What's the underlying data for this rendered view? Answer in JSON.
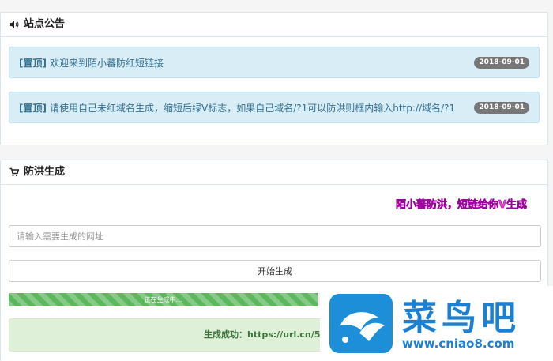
{
  "announcements": {
    "title": "站点公告",
    "items": [
      {
        "tag": "[置顶]",
        "text": "欢迎来到陌小蕃防红短链接",
        "date": "2018-09-01"
      },
      {
        "tag": "[置顶]",
        "text": "请使用自己未红域名生成，缩短后绿V标志，如果自己域名/?1可以防洪则框内输入http://域名/?1",
        "date": "2018-09-01"
      }
    ]
  },
  "generator": {
    "title": "防洪生成",
    "marquee": "陌小蕃防洪，短链给你V生成",
    "input_placeholder": "请输入需要生成的网址",
    "button_label": "开始生成",
    "progress_label": "正在生成中...",
    "progress_percent": 58,
    "success_text": "生成成功：https://url.cn/56C"
  },
  "watermark": {
    "name": "菜鸟吧",
    "url": "www.cniao8.com"
  }
}
